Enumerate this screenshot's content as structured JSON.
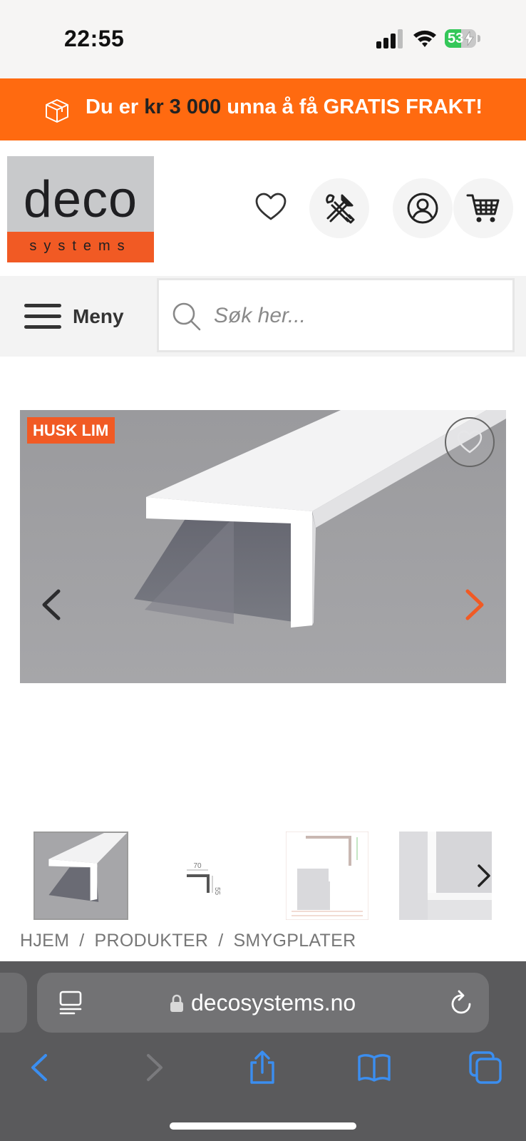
{
  "status_bar": {
    "time": "22:55",
    "battery": "53",
    "battery_level": 0.53
  },
  "promo": {
    "text_before": "Du er ",
    "amount": "kr 3 000",
    "text_after": " unna å få GRATIS FRAKT!"
  },
  "header": {
    "logo_word": "deco",
    "logo_sub": "systems"
  },
  "nav": {
    "menu_label": "Meny",
    "search_placeholder": "Søk her..."
  },
  "product": {
    "badge": "HUSK LIM"
  },
  "thumbnails": [
    {
      "name": "profile-render",
      "selected": true
    },
    {
      "name": "dimension-drawing",
      "dim_width": "70",
      "dim_height": "55"
    },
    {
      "name": "technical-sheet"
    },
    {
      "name": "installation-photo"
    }
  ],
  "breadcrumb": {
    "items": [
      "HJEM",
      "PRODUKTER",
      "SMYGPLATER"
    ],
    "separator": "/"
  },
  "browser": {
    "url": "decosystems.no"
  },
  "colors": {
    "accent": "#ff6a10",
    "brand_orange": "#f15a24",
    "ios_blue": "#3b8ef0",
    "battery_green": "#34c759"
  },
  "icons": [
    "shipping-box-icon",
    "heart-icon",
    "tools-icon",
    "user-icon",
    "cart-icon",
    "menu-icon",
    "search-icon",
    "chevron-left-icon",
    "chevron-right-icon",
    "lock-icon",
    "reload-icon",
    "share-icon",
    "bookmarks-icon",
    "tabs-icon"
  ]
}
